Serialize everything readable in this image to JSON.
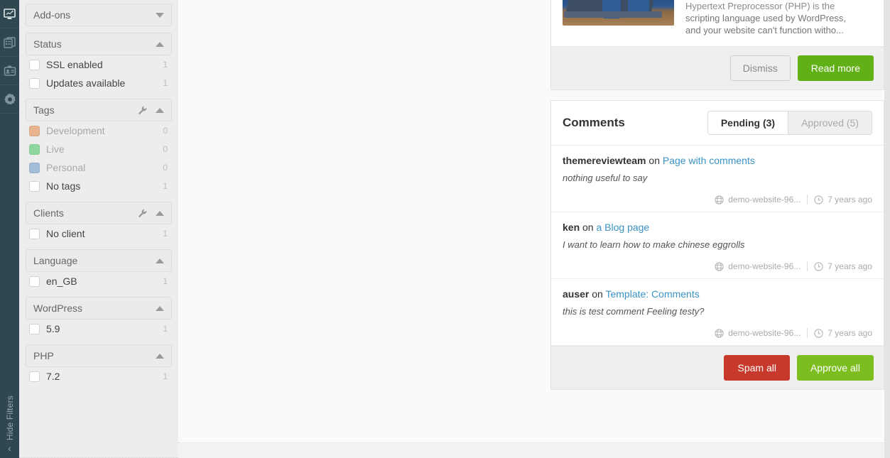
{
  "rail": {
    "items": [
      {
        "name": "dashboard-icon",
        "label": "Dashboard",
        "active": true
      },
      {
        "name": "sites-icon",
        "label": "Sites",
        "active": false
      },
      {
        "name": "clients-icon",
        "label": "Clients",
        "active": false
      },
      {
        "name": "settings-icon",
        "label": "Settings",
        "active": false
      }
    ],
    "hide_filters_label": "Hide Filters",
    "hide_filters_chevron": "‹"
  },
  "filters": {
    "groups": [
      {
        "title": "Add-ons",
        "collapsed": true,
        "has_wrench": false,
        "options": []
      },
      {
        "title": "Status",
        "collapsed": false,
        "has_wrench": false,
        "options": [
          {
            "label": "SSL enabled",
            "count": "1",
            "swatch": null,
            "muted": false
          },
          {
            "label": "Updates available",
            "count": "1",
            "swatch": null,
            "muted": false
          }
        ]
      },
      {
        "title": "Tags",
        "collapsed": false,
        "has_wrench": true,
        "options": [
          {
            "label": "Development",
            "count": "0",
            "swatch": "#e8b48d",
            "muted": true
          },
          {
            "label": "Live",
            "count": "0",
            "swatch": "#8ed8a0",
            "muted": true
          },
          {
            "label": "Personal",
            "count": "0",
            "swatch": "#a3bdd8",
            "muted": true
          },
          {
            "label": "No tags",
            "count": "1",
            "swatch": null,
            "muted": false
          }
        ]
      },
      {
        "title": "Clients",
        "collapsed": false,
        "has_wrench": true,
        "options": [
          {
            "label": "No client",
            "count": "1",
            "swatch": null,
            "muted": false
          }
        ]
      },
      {
        "title": "Language",
        "collapsed": false,
        "has_wrench": false,
        "options": [
          {
            "label": "en_GB",
            "count": "1",
            "swatch": null,
            "muted": false
          }
        ]
      },
      {
        "title": "WordPress",
        "collapsed": false,
        "has_wrench": false,
        "options": [
          {
            "label": "5.9",
            "count": "1",
            "swatch": null,
            "muted": false
          }
        ]
      },
      {
        "title": "PHP",
        "collapsed": false,
        "has_wrench": false,
        "options": [
          {
            "label": "7.2",
            "count": "1",
            "swatch": null,
            "muted": false
          }
        ]
      }
    ]
  },
  "news_card": {
    "text_line1": "Hypertext Preprocessor (PHP) is the",
    "text_line2": "scripting language used by WordPress,",
    "text_line3": "and your website can't function witho...",
    "dismiss_label": "Dismiss",
    "read_more_label": "Read more"
  },
  "comments": {
    "title": "Comments",
    "tabs": [
      {
        "label": "Pending (3)",
        "active": true
      },
      {
        "label": "Approved (5)",
        "active": false
      }
    ],
    "items": [
      {
        "author": "themereviewteam",
        "on": "on",
        "target": "Page with comments",
        "body": "nothing useful to say",
        "site": "demo-website-96...",
        "time": "7 years ago"
      },
      {
        "author": "ken",
        "on": "on",
        "target": "a Blog page",
        "body": "I want to learn how to make chinese eggrolls",
        "site": "demo-website-96...",
        "time": "7 years ago"
      },
      {
        "author": "auser",
        "on": "on",
        "target": "Template: Comments",
        "body": "this is test comment Feeling testy?",
        "site": "demo-website-96...",
        "time": "7 years ago"
      }
    ],
    "spam_all_label": "Spam all",
    "approve_all_label": "Approve all"
  },
  "colors": {
    "rail_bg": "#2e4750",
    "filters_bg": "#ededed",
    "accent_green": "#7cbe1f",
    "accent_green_dark": "#62b017",
    "accent_red": "#c6392b",
    "link_blue": "#3a93c4"
  }
}
